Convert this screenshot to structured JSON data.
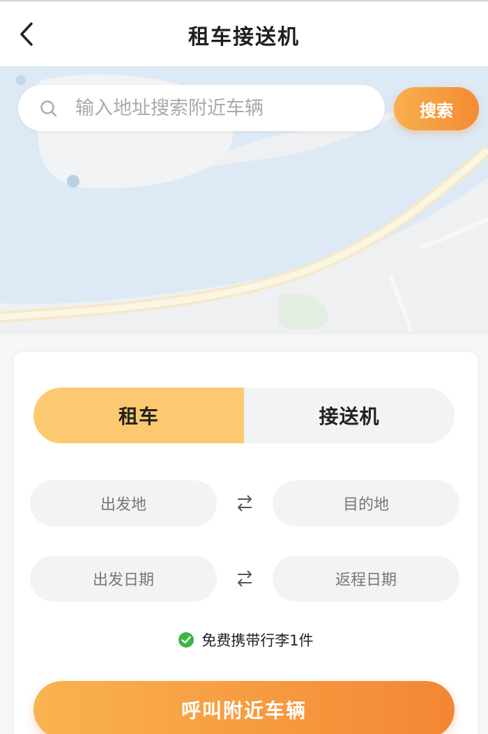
{
  "header": {
    "title": "租车接送机"
  },
  "search": {
    "placeholder": "输入地址搜索附近车辆",
    "button_label": "搜索"
  },
  "tabs": [
    {
      "label": "租车",
      "active": true
    },
    {
      "label": "接送机",
      "active": false
    }
  ],
  "route": {
    "origin_placeholder": "出发地",
    "destination_placeholder": "目的地",
    "depart_date_placeholder": "出发日期",
    "return_date_placeholder": "返程日期"
  },
  "luggage": {
    "text": "免费携带行李1件",
    "checked": true
  },
  "actions": {
    "call_label": "呼叫附近车辆"
  },
  "colors": {
    "accent": "#f38a34",
    "accent_light": "#fdc970",
    "check_green": "#3fb543"
  },
  "icons": {
    "back": "chevron-left-icon",
    "search": "search-icon",
    "swap": "swap-arrows-icon",
    "check": "check-circle-icon"
  }
}
